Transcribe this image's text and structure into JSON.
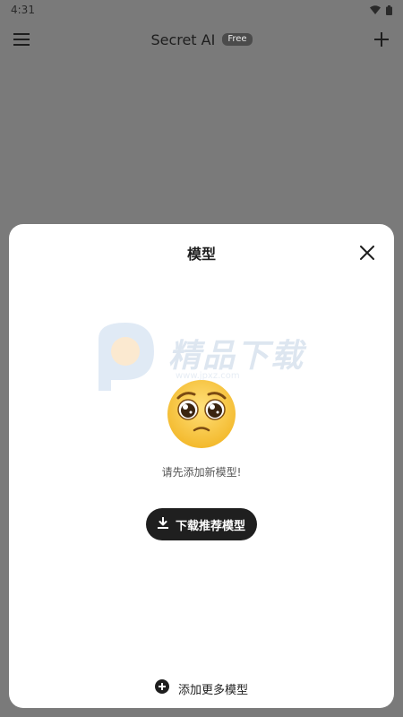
{
  "status_bar": {
    "time": "4:31",
    "icons": [
      "wifi-icon",
      "battery-icon"
    ]
  },
  "app_bar": {
    "menu_icon": "menu-icon",
    "title": "Secret AI",
    "badge": "Free",
    "add_icon": "plus-icon"
  },
  "sheet": {
    "title": "模型",
    "close_icon": "close-icon",
    "watermark": {
      "text": "精品下载",
      "url": "www.jpxz.com"
    },
    "emoji": "pleading-face-emoji",
    "empty_message": "请先添加新模型!",
    "download_button": {
      "label": "下载推荐模型",
      "icon": "download-icon"
    },
    "add_more": {
      "label": "添加更多模型",
      "icon": "plus-circle-icon"
    }
  },
  "colors": {
    "overlay": "#7a7a7a",
    "sheet_bg": "#ffffff",
    "button_bg": "#1f1f1f",
    "emoji_yellow": "#f7c93b"
  }
}
